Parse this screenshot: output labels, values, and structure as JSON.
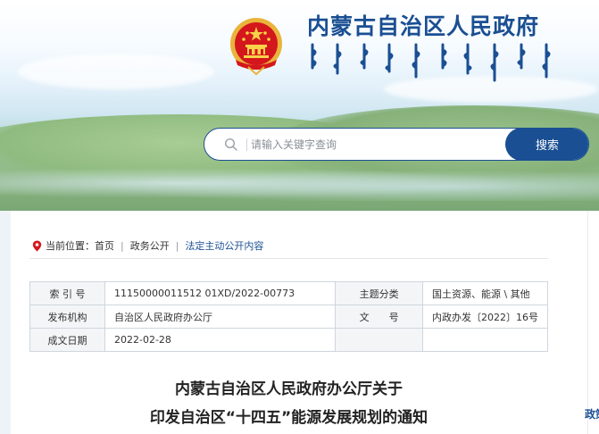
{
  "header": {
    "site_title": "内蒙古自治区人民政府"
  },
  "search": {
    "placeholder": "请输入关键字查询",
    "button_label": "搜索"
  },
  "breadcrumb": {
    "prefix": "当前位置：",
    "items": [
      "首页",
      "政务公开",
      "法定主动公开内容"
    ],
    "separator": "|"
  },
  "meta": {
    "rows": [
      {
        "label1": "索 引 号",
        "value1": "11150000011512 01XD/2022-00773",
        "label2": "主题分类",
        "value2": "国土资源、能源 \\ 其他"
      },
      {
        "label1": "发布机构",
        "value1": "自治区人民政府办公厅",
        "label2": "文　　号",
        "value2": "内政办发〔2022〕16号"
      },
      {
        "label1": "成文日期",
        "value1": "2022-02-28",
        "label2": "",
        "value2": ""
      }
    ]
  },
  "article": {
    "title_line1": "内蒙古自治区人民政府办公厅关于",
    "title_line2": "印发自治区“十四五”能源发展规划的通知"
  },
  "side": {
    "label": "政策"
  },
  "colors": {
    "brand_blue": "#1a4f93",
    "link_blue": "#1a4f93"
  }
}
